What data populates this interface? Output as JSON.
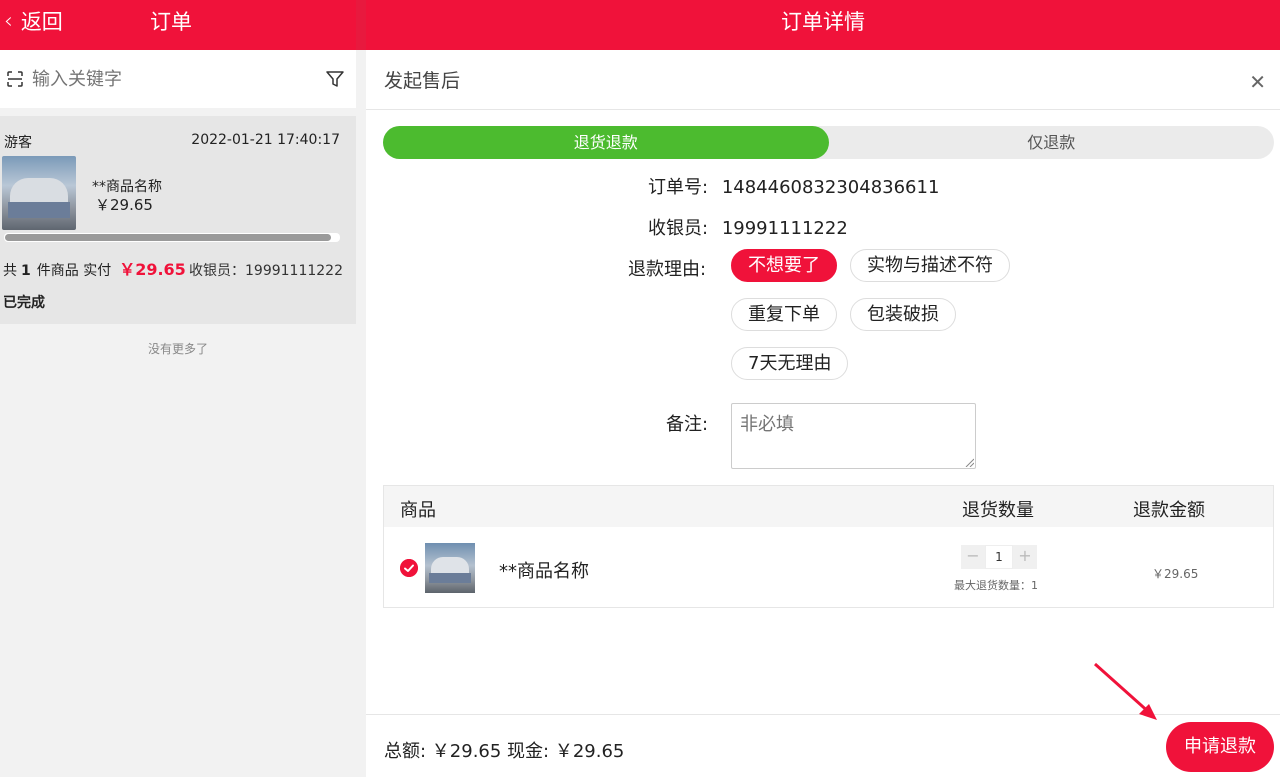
{
  "left": {
    "back_label": "返回",
    "title": "订单",
    "search_placeholder": "输入关键字",
    "order": {
      "customer": "游客",
      "datetime": "2022-01-21 17:40:17",
      "product_name": "**商品名称",
      "product_price": "￥29.65",
      "summary_prefix": "共",
      "count": "1",
      "summary_mid": "件商品 实付",
      "paid": "￥29.65",
      "cashier": "收银员：19991111222",
      "status": "已完成"
    },
    "no_more": "没有更多了"
  },
  "right": {
    "title": "订单详情",
    "modal_title": "发起售后",
    "tabs": [
      {
        "label": "退货退款",
        "active": true
      },
      {
        "label": "仅退款",
        "active": false
      }
    ],
    "order_no_label": "订单号:",
    "order_no": "1484460832304836611",
    "cashier_label": "收银员:",
    "cashier": "19991111222",
    "reason_label": "退款理由:",
    "reasons": [
      "不想要了",
      "实物与描述不符",
      "重复下单",
      "包装破损",
      "7天无理由"
    ],
    "selected_reason": "不想要了",
    "remark_label": "备注:",
    "remark_placeholder": "非必填",
    "table": {
      "headers": [
        "商品",
        "退货数量",
        "退款金额"
      ],
      "row": {
        "name": "**商品名称",
        "qty": "1",
        "max_qty": "最大退货数量：1",
        "amount": "￥29.65"
      }
    },
    "footer": {
      "totals": "总额: ￥29.65 现金: ￥29.65",
      "apply_label": "申请退款"
    }
  },
  "colors": {
    "brand_red": "#f0123a",
    "active_green": "#4cbb2f"
  }
}
